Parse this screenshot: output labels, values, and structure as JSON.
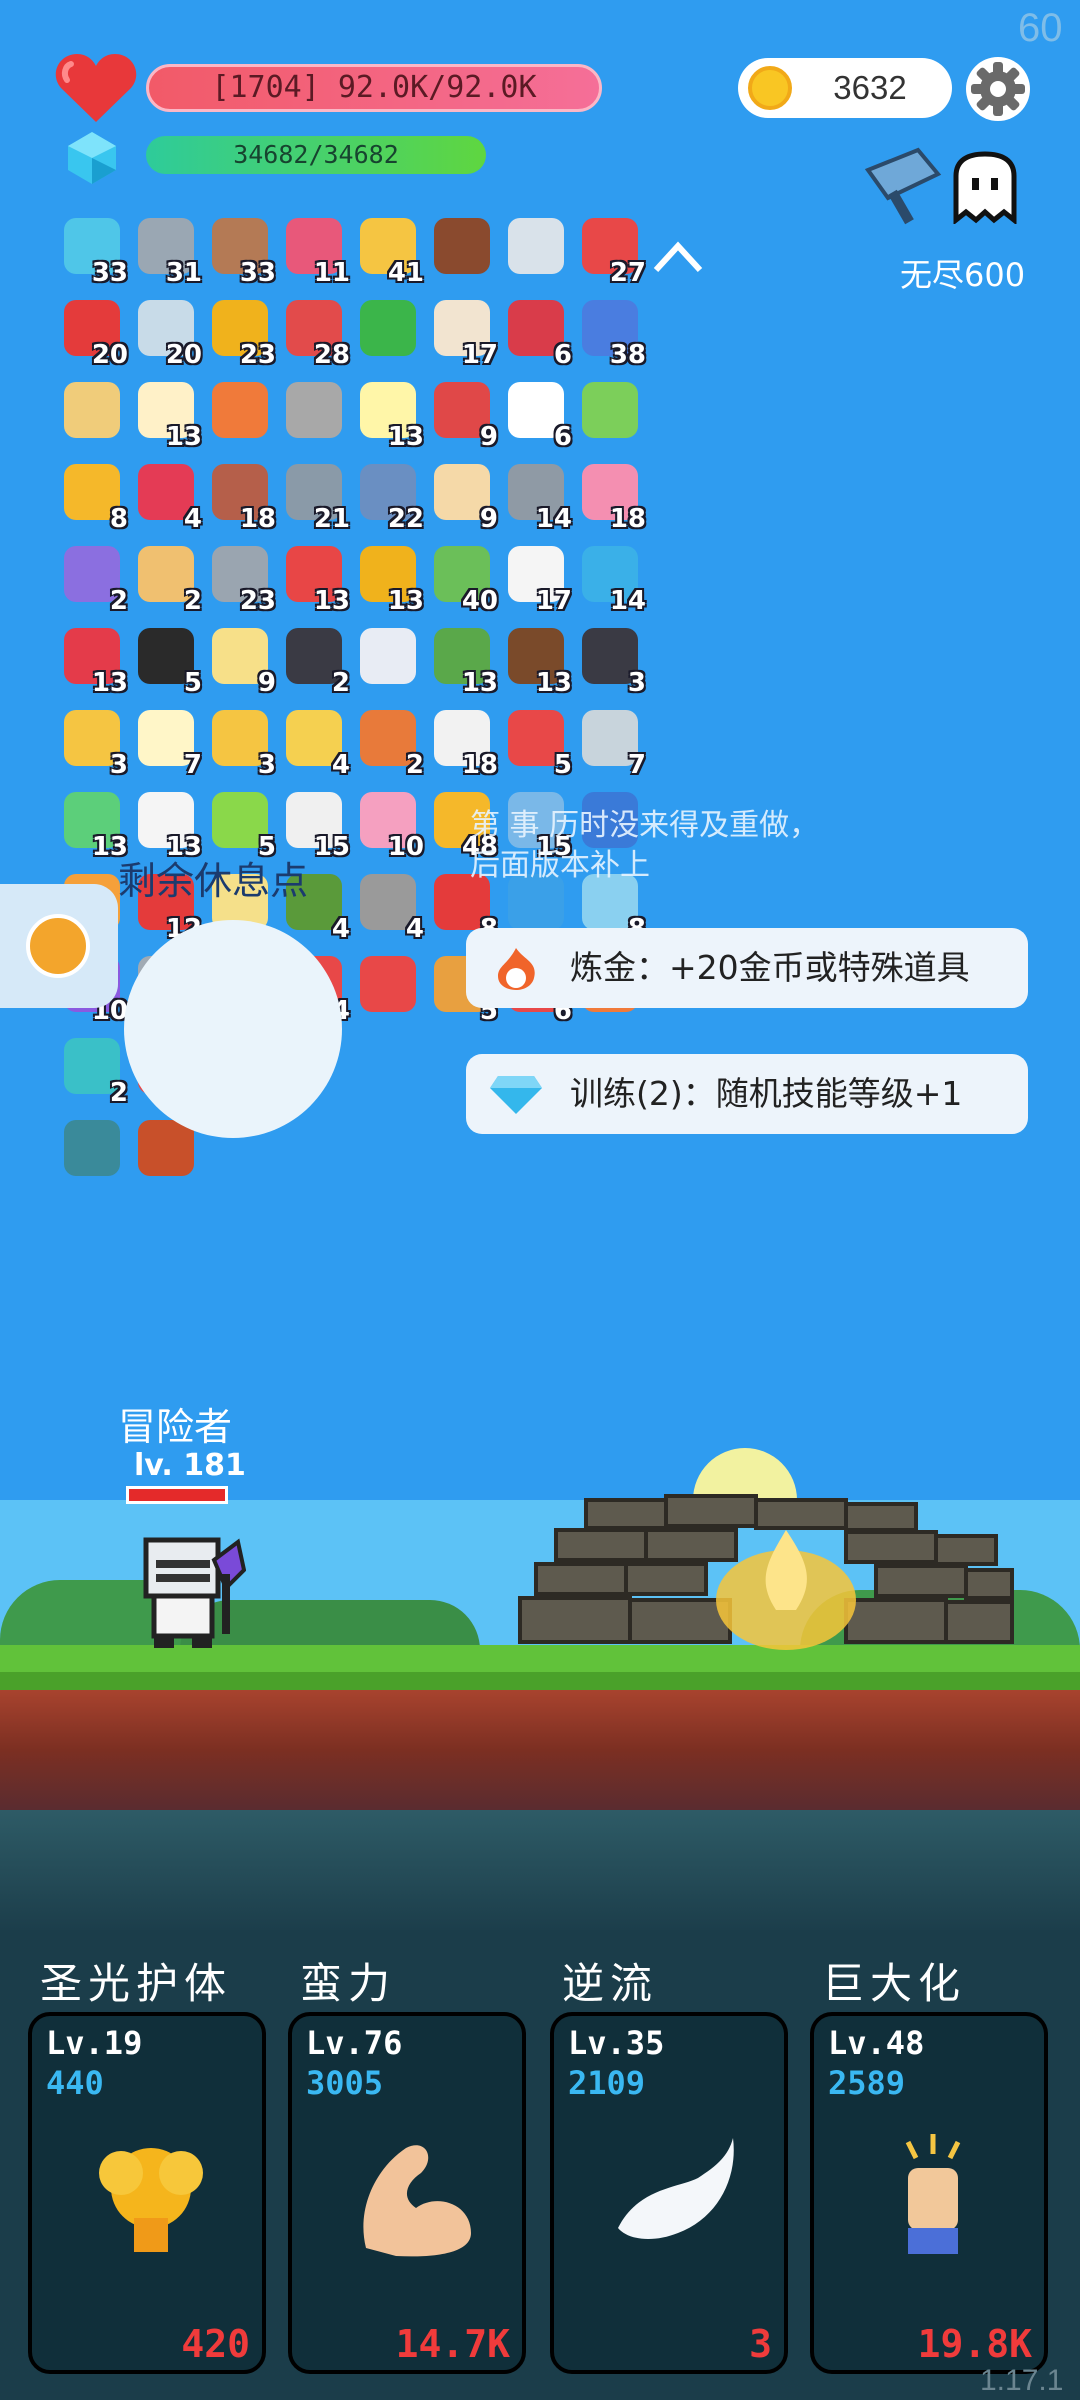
{
  "fps": "60",
  "hud": {
    "hp_text": "[1704] 92.0K/92.0K",
    "mp_text": "34682/34682",
    "coins": "3632",
    "endless_label": "无尽600"
  },
  "items": [
    {
      "n": "33",
      "c": "#4fc6e8",
      "icon": "needle-icon"
    },
    {
      "n": "31",
      "c": "#9aa7b3",
      "icon": "sword-icon"
    },
    {
      "n": "33",
      "c": "#b47a55",
      "icon": "donut-icon"
    },
    {
      "n": "11",
      "c": "#e8587a",
      "icon": "jam-jar-icon"
    },
    {
      "n": "41",
      "c": "#f5c542",
      "icon": "bulb-icon"
    },
    {
      "n": "",
      "c": "#8a4a2e",
      "icon": "mushroom-icon"
    },
    {
      "n": "",
      "c": "#d9e2ea",
      "icon": "blade-icon"
    },
    {
      "n": "27",
      "c": "#e84848",
      "icon": "watermelon-icon"
    },
    {
      "n": "20",
      "c": "#e43b3b",
      "icon": "apple-icon"
    },
    {
      "n": "20",
      "c": "#c8dbe8",
      "icon": "molecule-icon"
    },
    {
      "n": "23",
      "c": "#f0b21c",
      "icon": "pineapple-icon"
    },
    {
      "n": "28",
      "c": "#e24b4b",
      "icon": "dagger-icon"
    },
    {
      "n": "",
      "c": "#3bb54a",
      "icon": "biohazard-icon"
    },
    {
      "n": "17",
      "c": "#f2e4d0",
      "icon": "flag-icon"
    },
    {
      "n": "6",
      "c": "#d93c4a",
      "icon": "shield-badge-icon"
    },
    {
      "n": "38",
      "c": "#4a7de0",
      "icon": "star-card-icon"
    },
    {
      "n": "",
      "c": "#f0cc7a",
      "icon": "scroll-icon"
    },
    {
      "n": "13",
      "c": "#fff1c8",
      "icon": "egg-icon"
    },
    {
      "n": "",
      "c": "#f07a3a",
      "icon": "torch-icon"
    },
    {
      "n": "",
      "c": "#a8a8a8",
      "icon": "helmet-icon"
    },
    {
      "n": "13",
      "c": "#fff6a8",
      "icon": "flower-icon"
    },
    {
      "n": "9",
      "c": "#e04848",
      "icon": "sock-icon"
    },
    {
      "n": "6",
      "c": "#ffffff",
      "icon": "clipboard-icon"
    },
    {
      "n": "",
      "c": "#7ccf5a",
      "icon": "flask-icon"
    },
    {
      "n": "8",
      "c": "#f5b82a",
      "icon": "sunflower-icon"
    },
    {
      "n": "4",
      "c": "#e43b55",
      "icon": "hearts-icon"
    },
    {
      "n": "18",
      "c": "#b55f4a",
      "icon": "gate-icon"
    },
    {
      "n": "21",
      "c": "#8a9aa8",
      "icon": "hook-icon"
    },
    {
      "n": "22",
      "c": "#6a8fc2",
      "icon": "shield-icon"
    },
    {
      "n": "9",
      "c": "#f5d9a8",
      "icon": "fist-icon"
    },
    {
      "n": "14",
      "c": "#8f9aa5",
      "icon": "elephant-icon"
    },
    {
      "n": "18",
      "c": "#f48fb1",
      "icon": "icecream-icon"
    },
    {
      "n": "2",
      "c": "#8b6fe0",
      "icon": "star-shield-icon"
    },
    {
      "n": "2",
      "c": "#f0c070",
      "icon": "mustache-icon"
    },
    {
      "n": "23",
      "c": "#9aa5b0",
      "icon": "spikeball-icon"
    },
    {
      "n": "13",
      "c": "#e84646",
      "icon": "target-icon"
    },
    {
      "n": "13",
      "c": "#f0b21c",
      "icon": "pineapple-small-icon"
    },
    {
      "n": "40",
      "c": "#6bbf59",
      "icon": "cash-icon"
    },
    {
      "n": "17",
      "c": "#f5f5f5",
      "icon": "mail-icon"
    },
    {
      "n": "14",
      "c": "#3ab0e8",
      "icon": "chat-icon"
    },
    {
      "n": "13",
      "c": "#e43b4a",
      "icon": "heart-icon"
    },
    {
      "n": "5",
      "c": "#2a2a2a",
      "icon": "cauldron-icon"
    },
    {
      "n": "9",
      "c": "#f7e089",
      "icon": "note-icon"
    },
    {
      "n": "2",
      "c": "#3a3a44",
      "icon": "bat-icon"
    },
    {
      "n": "",
      "c": "#e8ecf4",
      "icon": "pill-icon"
    },
    {
      "n": "13",
      "c": "#5aa84a",
      "icon": "bow-icon"
    },
    {
      "n": "13",
      "c": "#7a4a2a",
      "icon": "coconut-icon"
    },
    {
      "n": "3",
      "c": "#3a3a44",
      "icon": "skull-book-icon"
    },
    {
      "n": "3",
      "c": "#f5c542",
      "icon": "ring-icon"
    },
    {
      "n": "7",
      "c": "#fff6c8",
      "icon": "lightbulb-icon"
    },
    {
      "n": "3",
      "c": "#f5c542",
      "icon": "battery-icon"
    },
    {
      "n": "4",
      "c": "#f5d050",
      "icon": "cheese-icon"
    },
    {
      "n": "2",
      "c": "#e87a3a",
      "icon": "briefcase-icon"
    },
    {
      "n": "18",
      "c": "#f2f2f2",
      "icon": "cards-icon"
    },
    {
      "n": "5",
      "c": "#e84848",
      "icon": "gift-icon"
    },
    {
      "n": "7",
      "c": "#c8d4dc",
      "icon": "disc-icon"
    },
    {
      "n": "13",
      "c": "#5ccf7a",
      "icon": "potion-icon"
    },
    {
      "n": "13",
      "c": "#f5f5f5",
      "icon": "dice-icon"
    },
    {
      "n": "5",
      "c": "#8ad84a",
      "icon": "lime-icon"
    },
    {
      "n": "15",
      "c": "#f0f0f0",
      "icon": "cloud-icon"
    },
    {
      "n": "10",
      "c": "#f5a0c0",
      "icon": "spray-icon"
    },
    {
      "n": "48",
      "c": "#f5b82a",
      "icon": "coins-stack-icon"
    },
    {
      "n": "15",
      "c": "#7ab8e8",
      "icon": "shirt-icon"
    },
    {
      "n": "",
      "c": "#3a7ad8",
      "icon": "crosshair-icon"
    },
    {
      "n": "",
      "c": "#f5a03a",
      "icon": "bag-icon"
    },
    {
      "n": "12",
      "c": "#e43b3b",
      "icon": "strawberry-icon"
    },
    {
      "n": "",
      "c": "#f5e08a",
      "icon": "map-icon"
    },
    {
      "n": "4",
      "c": "#5a9a3a",
      "icon": "grenade-icon"
    },
    {
      "n": "4",
      "c": "#9a9a9a",
      "icon": "meteor-icon"
    },
    {
      "n": "8",
      "c": "#e43b3b",
      "icon": "toadstool-icon"
    },
    {
      "n": "",
      "c": "#3aa0e8",
      "icon": "sapphire-icon"
    },
    {
      "n": "8",
      "c": "#8ad0f0",
      "icon": "vial-icon"
    },
    {
      "n": "10",
      "c": "#8a5ae0",
      "icon": "purple-item-icon"
    },
    {
      "n": "4",
      "c": "#a0aab4",
      "icon": "compass-icon"
    },
    {
      "n": "6",
      "c": "#e84848",
      "icon": "heat-icon"
    },
    {
      "n": "4",
      "c": "#e84848",
      "icon": "pin-icon"
    },
    {
      "n": "",
      "c": "#e84848",
      "icon": "bookmark-icon"
    },
    {
      "n": "5",
      "c": "#e8a040",
      "icon": "book-icon"
    },
    {
      "n": "6",
      "c": "#e84848",
      "icon": "thermometer-icon"
    },
    {
      "n": "",
      "c": "#f07a3a",
      "icon": "fire-face-icon"
    },
    {
      "n": "2",
      "c": "#3ac0c8",
      "icon": "spiral-icon"
    },
    {
      "n": "",
      "c": "#e84848",
      "icon": "percent-icon"
    },
    {
      "n": "",
      "c": "#f5c542",
      "icon": "magic-wand-icon"
    },
    {
      "n": "",
      "c": "#3a8a9a",
      "icon": "light-tile-icon"
    },
    {
      "n": "",
      "c": "#c8502a",
      "icon": "fire-tile-icon"
    }
  ],
  "event_notice": {
    "line1": "第  事   历时没来得及重做，",
    "line2": "后面版本补上"
  },
  "rest_label": "剩余休息点",
  "options": [
    {
      "text": "炼金：+20金币或特殊道具",
      "icon": "fire-face-icon"
    },
    {
      "text": "训练(2)：随机技能等级+1",
      "icon": "diamond-icon"
    }
  ],
  "player": {
    "name": "冒险者",
    "level": "lv. 181",
    "hp_fraction": 1.0
  },
  "skills": [
    {
      "title": "圣光护体",
      "lv": "Lv.19",
      "power": "440",
      "cost": "420",
      "icon": "golden-angel-icon"
    },
    {
      "title": "蛮力",
      "lv": "Lv.76",
      "power": "3005",
      "cost": "14.7K",
      "icon": "flexed-arm-icon"
    },
    {
      "title": "逆流",
      "lv": "Lv.35",
      "power": "2109",
      "cost": "3",
      "icon": "wing-icon"
    },
    {
      "title": "巨大化",
      "lv": "Lv.48",
      "power": "2589",
      "cost": "19.8K",
      "icon": "raised-fist-icon"
    }
  ],
  "version": "1.17.1"
}
